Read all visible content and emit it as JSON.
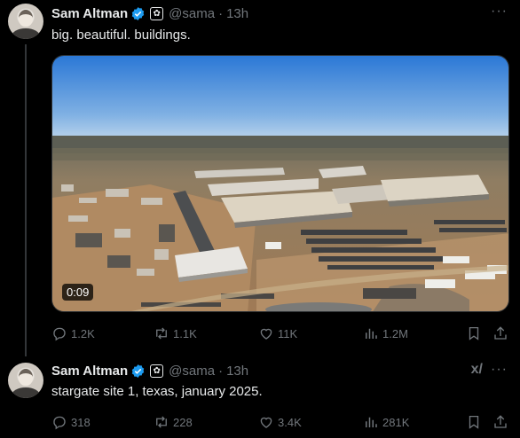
{
  "tweets": [
    {
      "author": "Sam Altman",
      "handle": "@sama",
      "separator": "·",
      "time": "13h",
      "text": "big. beautiful. buildings.",
      "media": {
        "duration": "0:09"
      },
      "stats": {
        "replies": "1.2K",
        "reposts": "1.1K",
        "likes": "11K",
        "views": "1.2M"
      }
    },
    {
      "author": "Sam Altman",
      "handle": "@sama",
      "separator": "·",
      "time": "13h",
      "text": "stargate site 1, texas, january 2025.",
      "stats": {
        "replies": "318",
        "reposts": "228",
        "likes": "3.4K",
        "views": "281K"
      }
    }
  ],
  "more_glyph": "···",
  "grok_glyph": "x/",
  "colors": {
    "background": "#000000",
    "text": "#e7e9ea",
    "muted": "#71767b",
    "verified": "#1d9bf0"
  }
}
